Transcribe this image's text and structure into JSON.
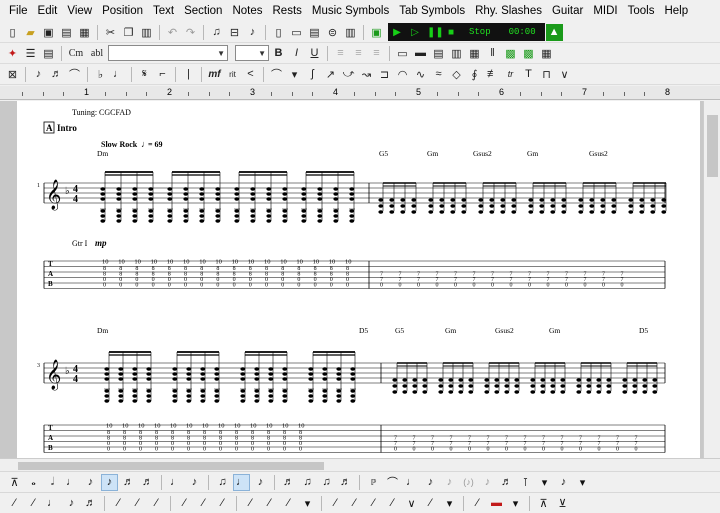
{
  "menu": [
    "File",
    "Edit",
    "View",
    "Position",
    "Text",
    "Section",
    "Notes",
    "Rests",
    "Music Symbols",
    "Tab Symbols",
    "Rhy. Slashes",
    "Guitar",
    "MIDI",
    "Tools",
    "Help"
  ],
  "toolbar": {
    "transport_label": "Stop",
    "time_display": "00:00",
    "combo_cm": "Cm",
    "combo_abl": "abl",
    "bold": "B",
    "italic": "I",
    "underline": "U"
  },
  "ruler": {
    "marks": [
      "1",
      "2",
      "3",
      "4",
      "5",
      "6",
      "7",
      "8"
    ]
  },
  "score": {
    "tuning": "Tuning: CGCFAD",
    "section_letter": "A",
    "section_name": "Intro",
    "tempo": "Slow Rock",
    "tempo_value": "= 69",
    "dynamic": "mp",
    "guitar_label": "Gtr I",
    "system1": {
      "chords": [
        "Dm",
        "G5",
        "Gm",
        "Gsus2",
        "Gm",
        "Gsus2"
      ],
      "measure_number": "1",
      "tab_top": [
        "10",
        "10",
        "10",
        "10",
        "10",
        "10",
        "10",
        "10",
        "10",
        "10",
        "10",
        "10",
        "10",
        "10",
        "10",
        "10"
      ],
      "tab_mid": [
        "8",
        "8",
        "8",
        "8",
        "8",
        "8",
        "8",
        "8",
        "8",
        "8",
        "8",
        "8",
        "8",
        "8",
        "8",
        "8"
      ],
      "tab_bottom_r": [
        "7",
        "7",
        "7",
        "7",
        "7",
        "7",
        "7",
        "7",
        "7",
        "7",
        "7",
        "7",
        "7",
        "7"
      ]
    },
    "system2": {
      "chords": [
        "Dm",
        "D5",
        "G5",
        "Gm",
        "Gsus2",
        "Gm",
        "D5"
      ],
      "measure_number": "3",
      "tab_top": [
        "10",
        "10",
        "10",
        "10",
        "10",
        "10",
        "10",
        "10",
        "10",
        "10",
        "10",
        "10",
        "10"
      ]
    }
  },
  "colors": {
    "transport_bg": "#111111",
    "transport_fg": "#20e020",
    "page": "#ffffff",
    "workspace": "#c8c8c8"
  }
}
